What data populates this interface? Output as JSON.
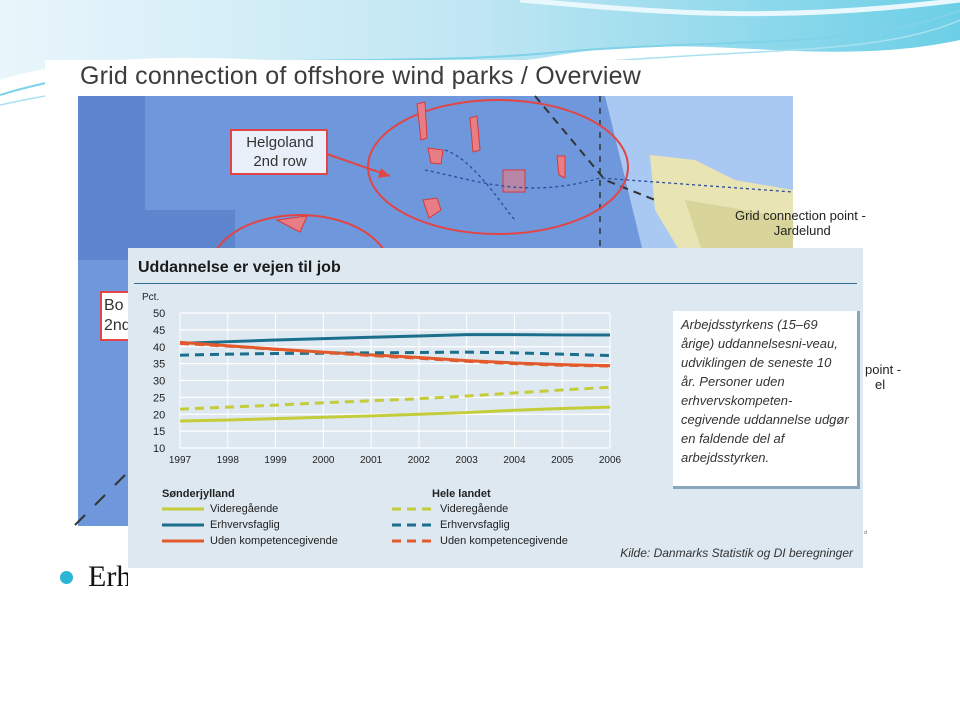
{
  "background_image": {
    "title": "Grid connection of offshore wind parks / Overview",
    "labels": {
      "helgoland": [
        "Helgoland",
        "2nd row"
      ],
      "grid_connection": [
        "Grid connection point -",
        "Jardelund"
      ],
      "partial_left": [
        "Bo",
        "2nd"
      ],
      "partial_right": [
        "point -",
        "el"
      ],
      "tiny": "e d"
    }
  },
  "bullet": {
    "text": "Erh"
  },
  "chart_data": {
    "type": "line",
    "title": "Uddannelse er vejen til job",
    "ylabel": "Pct.",
    "ylim": [
      10,
      50
    ],
    "yticks": [
      10,
      15,
      20,
      25,
      30,
      35,
      40,
      45,
      50
    ],
    "x": [
      1997,
      1998,
      1999,
      2000,
      2001,
      2002,
      2003,
      2004,
      2005,
      2006
    ],
    "grid": true,
    "series": [
      {
        "name": "Videregående",
        "group": "Sønderjylland",
        "style": "solid",
        "color": "#c5cc39",
        "values": [
          18,
          18.3,
          18.7,
          19.1,
          19.5,
          20,
          20.5,
          21.2,
          21.7,
          22.1
        ]
      },
      {
        "name": "Erhvervsfaglig",
        "group": "Sønderjylland",
        "style": "solid",
        "color": "#1b6f8c",
        "values": [
          41,
          41.5,
          42,
          42.4,
          42.8,
          43.2,
          43.6,
          43.6,
          43.5,
          43.5
        ]
      },
      {
        "name": "Uden kompetencegivende",
        "group": "Sønderjylland",
        "style": "solid",
        "color": "#e25a2c",
        "values": [
          41.3,
          40.3,
          39.3,
          38.4,
          37.6,
          36.8,
          35.9,
          35.2,
          34.7,
          34.4
        ]
      },
      {
        "name": "Videregående",
        "group": "Hele landet",
        "style": "dashed",
        "color": "#c5cc39",
        "values": [
          21.5,
          22.1,
          22.7,
          23.4,
          24,
          24.6,
          25.4,
          26.3,
          27.2,
          28
        ]
      },
      {
        "name": "Erhvervsfaglig",
        "group": "Hele landet",
        "style": "dashed",
        "color": "#1b6f8c",
        "values": [
          37.5,
          37.8,
          38,
          38.1,
          38.2,
          38.3,
          38.4,
          38.2,
          37.8,
          37.4
        ]
      },
      {
        "name": "Uden kompetencegivende",
        "group": "Hele landet",
        "style": "dashed",
        "color": "#e25a2c",
        "values": [
          41,
          40.2,
          39.2,
          38.3,
          37.4,
          36.6,
          35.7,
          35,
          34.5,
          34.3
        ]
      }
    ],
    "legend": {
      "groups": [
        "Sønderjylland",
        "Hele landet"
      ]
    },
    "note": "Arbejdsstyrkens (15–69 årige) uddannelsesni-veau, udviklingen de seneste 10 år. Personer uden erhvervskompeten-cegivende uddannelse udgør en faldende del af arbejdsstyrken.",
    "source": "Kilde: Danmarks Statistik og DI beregninger"
  },
  "colors": {
    "sea": "#5b89d6",
    "sea_light": "#7fa8e6",
    "land": "#e8e4b4",
    "accent": "#2ab6d4",
    "chart_bg": "#dde8f0"
  }
}
